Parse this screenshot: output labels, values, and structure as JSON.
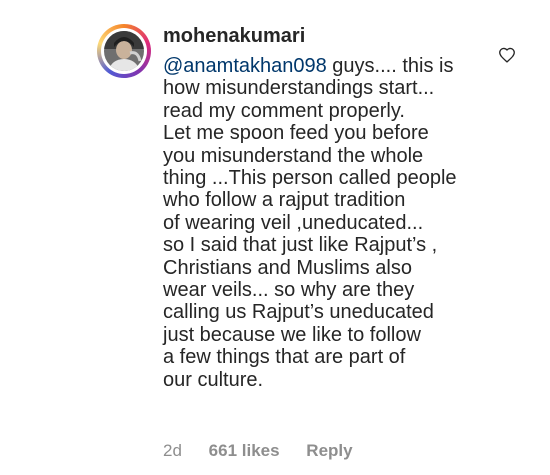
{
  "comment": {
    "username": "mohenakumari",
    "mention": "@anamtakhan098",
    "first_line_rest": " guys.... this is",
    "lines": [
      "how misunderstandings start...",
      "read my comment properly.",
      "Let me spoon feed you before",
      "you misunderstand the whole",
      "thing ...This person called people",
      "who follow a rajput tradition",
      "of wearing veil ,uneducated...",
      "so I said that just like Rajput’s ,",
      "Christians and Muslims also",
      "wear veils... so why are they",
      "calling us Rajput’s uneducated",
      "just because we like to follow",
      "a few things that are part of",
      "our culture."
    ],
    "time": "2d",
    "likes": "661 likes",
    "reply": "Reply",
    "like_icon": "heart-outline-icon"
  },
  "colors": {
    "text": "#262626",
    "mention": "#00376b",
    "meta": "#8e8e8e"
  }
}
